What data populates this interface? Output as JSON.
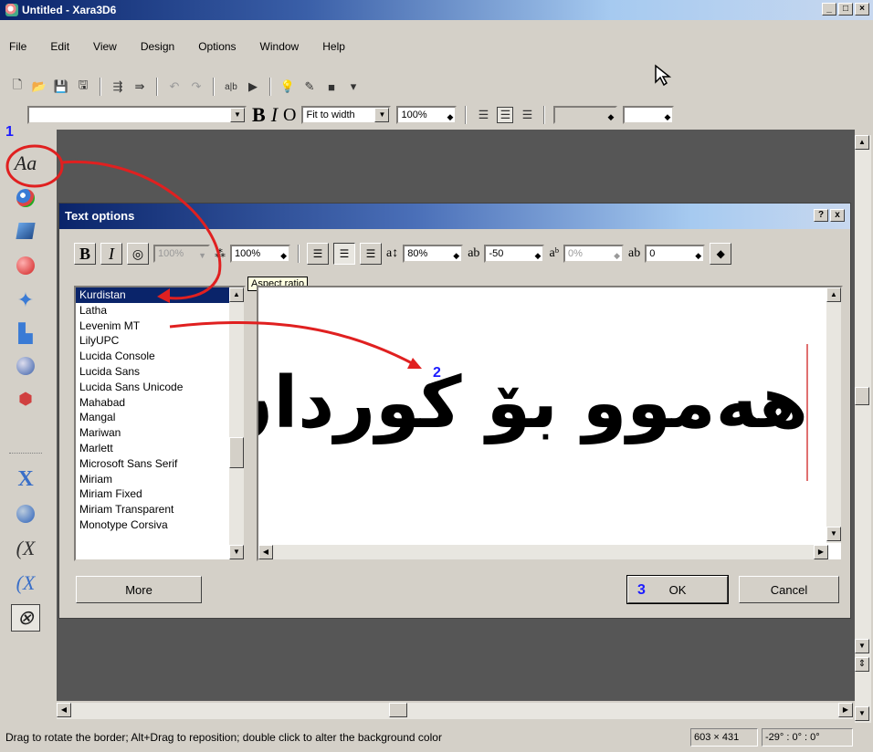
{
  "window": {
    "title": "Untitled - Xara3D6"
  },
  "menu": [
    "File",
    "Edit",
    "View",
    "Design",
    "Options",
    "Window",
    "Help"
  ],
  "toolbar2": {
    "font_combo": "",
    "fit_select": "Fit to width",
    "zoom": "100%"
  },
  "left_tools": {
    "text_tool_label": "Aa"
  },
  "dialog": {
    "title": "Text options",
    "help_btn": "?",
    "close_btn": "x",
    "width_value": "100%",
    "aspect_value": "100%",
    "line_spacing": "80%",
    "char_spacing": "-50",
    "superscript": "0%",
    "baseline": "0",
    "tooltip": "Aspect ratio",
    "fonts": [
      "Kurdistan",
      "Latha",
      "Levenim MT",
      "LilyUPC",
      "Lucida Console",
      "Lucida Sans",
      "Lucida Sans Unicode",
      "Mahabad",
      "Mangal",
      "Mariwan",
      "Marlett",
      "Microsoft Sans Serif",
      "Miriam",
      "Miriam Fixed",
      "Miriam Transparent",
      "Monotype Corsiva"
    ],
    "selected_font": "Kurdistan",
    "preview_text": "هەموو بۆ کوردان",
    "more_btn": "More",
    "ok_btn": "OK",
    "cancel_btn": "Cancel"
  },
  "markers": {
    "one": "1",
    "two": "2",
    "three": "3"
  },
  "status": {
    "message": "Drag to rotate the border; Alt+Drag to reposition; double click to alter the background color",
    "size": "603 × 431",
    "rotation": "-29° : 0° : 0°"
  },
  "colors": {
    "title_active": "#0a246a",
    "canvas_bg": "#565656",
    "annotation_red": "#e02020",
    "marker_blue": "#1c1cff"
  }
}
